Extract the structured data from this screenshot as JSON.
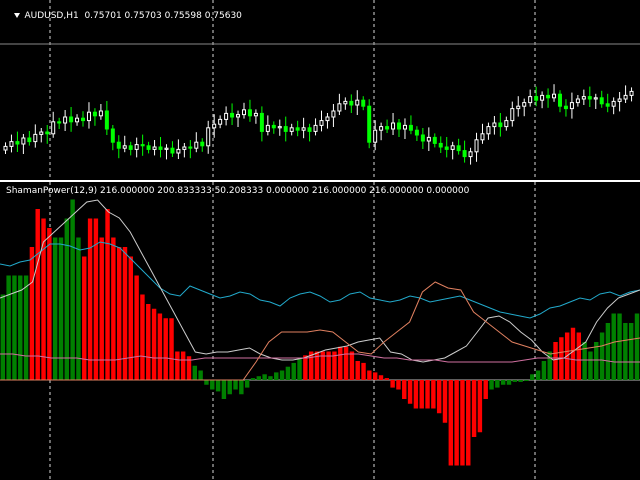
{
  "window": {
    "symbol_timeframe": "AUDUSD,H1",
    "ohlc": "0.75701 0.75703 0.75598 0.75630"
  },
  "indicator": {
    "label": "ShamanPower(12,9) 216.000000 200.833333 50.208333 0.000000 216.000000 216.000000 0.000000"
  },
  "colors": {
    "bull_candle": "#ffffff",
    "bear_candle": "#00ff00",
    "grid": "#ffffff",
    "bar_up": "#008000",
    "bar_down": "#ff0000",
    "line_cyan": "#22aacc",
    "line_white": "#cccccc",
    "line_pink": "#d070a0",
    "line_salmon": "#e08060",
    "line_green": "#70a060"
  },
  "icons": {
    "menu": "triangle-down-icon"
  }
}
